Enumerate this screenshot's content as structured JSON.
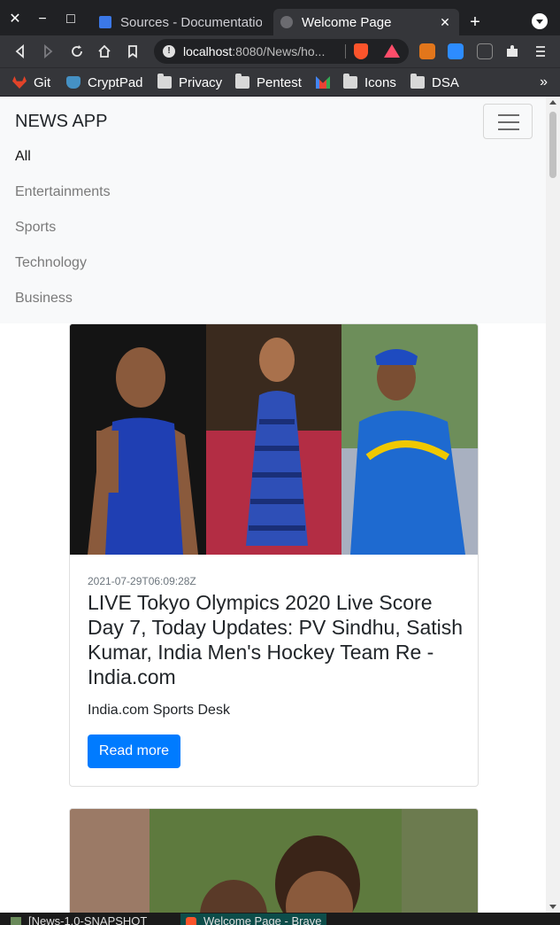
{
  "window": {
    "close_label": "✕",
    "minimize_label": "−",
    "maximize_label": "□"
  },
  "tabs": [
    {
      "label": "Sources - Documentation",
      "active": false
    },
    {
      "label": "Welcome Page",
      "active": true,
      "close": "✕"
    }
  ],
  "new_tab_label": "+",
  "address_bar": {
    "host": "localhost",
    "rest": ":8080/News/ho..."
  },
  "bookmarks": [
    {
      "label": "Git",
      "icon": "gitlab-icon"
    },
    {
      "label": "CryptPad",
      "icon": "cryptpad-icon"
    },
    {
      "label": "Privacy",
      "icon": "folder-icon"
    },
    {
      "label": "Pentest",
      "icon": "folder-icon"
    },
    {
      "label": "",
      "icon": "gmail-icon"
    },
    {
      "label": "Icons",
      "icon": "folder-icon"
    },
    {
      "label": "DSA",
      "icon": "folder-icon"
    }
  ],
  "bookmarks_more": "»",
  "navbar": {
    "brand": "NEWS APP",
    "links": [
      "All",
      "Entertainments",
      "Sports",
      "Technology",
      "Business"
    ],
    "active_link": "All"
  },
  "articles": [
    {
      "date": "2021-07-29T06:09:28Z",
      "title": "LIVE Tokyo Olympics 2020 Live Score Day 7, Today Updates: PV Sindhu, Satish Kumar, India Men's Hockey Team Re - India.com",
      "source": "India.com Sports Desk",
      "button": "Read more"
    }
  ],
  "taskbar": [
    {
      "label": "[News-1.0-SNAPSHOT",
      "active": false
    },
    {
      "label": "Welcome Page - Brave",
      "active": true
    }
  ],
  "colors": {
    "primary_button": "#007bff",
    "navbar_bg": "#f8f9fa",
    "browser_chrome": "#35363a"
  }
}
